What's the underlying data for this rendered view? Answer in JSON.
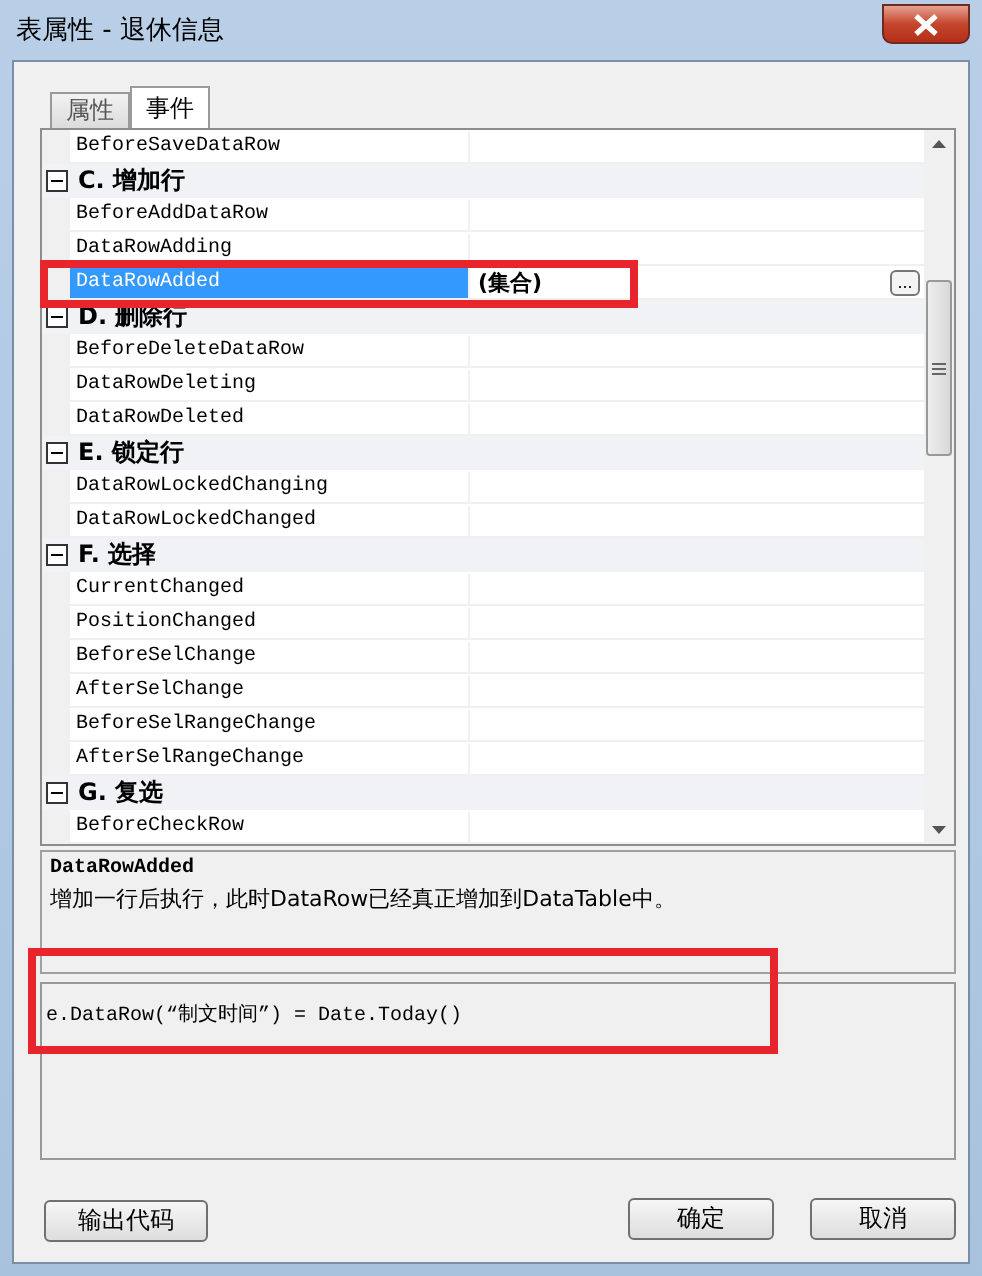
{
  "window": {
    "title": "表属性 - 退休信息"
  },
  "tabs": [
    {
      "label": "属性",
      "selected": false
    },
    {
      "label": "事件",
      "selected": true
    }
  ],
  "grid": {
    "rows": [
      {
        "kind": "item",
        "name": "BeforeSaveDataRow",
        "selected": false
      },
      {
        "kind": "category",
        "name": "C. 增加行",
        "expanded": true
      },
      {
        "kind": "item",
        "name": "BeforeAddDataRow",
        "selected": false
      },
      {
        "kind": "item",
        "name": "DataRowAdding",
        "selected": false
      },
      {
        "kind": "item",
        "name": "DataRowAdded",
        "selected": true,
        "value": "(集合)",
        "button": "..."
      },
      {
        "kind": "category",
        "name": "D. 删除行",
        "expanded": true
      },
      {
        "kind": "item",
        "name": "BeforeDeleteDataRow",
        "selected": false
      },
      {
        "kind": "item",
        "name": "DataRowDeleting",
        "selected": false
      },
      {
        "kind": "item",
        "name": "DataRowDeleted",
        "selected": false
      },
      {
        "kind": "category",
        "name": "E. 锁定行",
        "expanded": true
      },
      {
        "kind": "item",
        "name": "DataRowLockedChanging",
        "selected": false
      },
      {
        "kind": "item",
        "name": "DataRowLockedChanged",
        "selected": false
      },
      {
        "kind": "category",
        "name": "F. 选择",
        "expanded": true
      },
      {
        "kind": "item",
        "name": "CurrentChanged",
        "selected": false
      },
      {
        "kind": "item",
        "name": "PositionChanged",
        "selected": false
      },
      {
        "kind": "item",
        "name": "BeforeSelChange",
        "selected": false
      },
      {
        "kind": "item",
        "name": "AfterSelChange",
        "selected": false
      },
      {
        "kind": "item",
        "name": "BeforeSelRangeChange",
        "selected": false
      },
      {
        "kind": "item",
        "name": "AfterSelRangeChange",
        "selected": false
      },
      {
        "kind": "category",
        "name": "G. 复选",
        "expanded": true
      },
      {
        "kind": "item",
        "name": "BeforeCheckRow",
        "selected": false
      }
    ]
  },
  "description": {
    "title": "DataRowAdded",
    "text": "增加一行后执行，此时DataRow已经真正增加到DataTable中。"
  },
  "code": {
    "value": "e.DataRow(“制文时间”) = Date.Today()"
  },
  "buttons": {
    "left": [
      "输出代码"
    ],
    "right": [
      "确定",
      "取消"
    ]
  }
}
